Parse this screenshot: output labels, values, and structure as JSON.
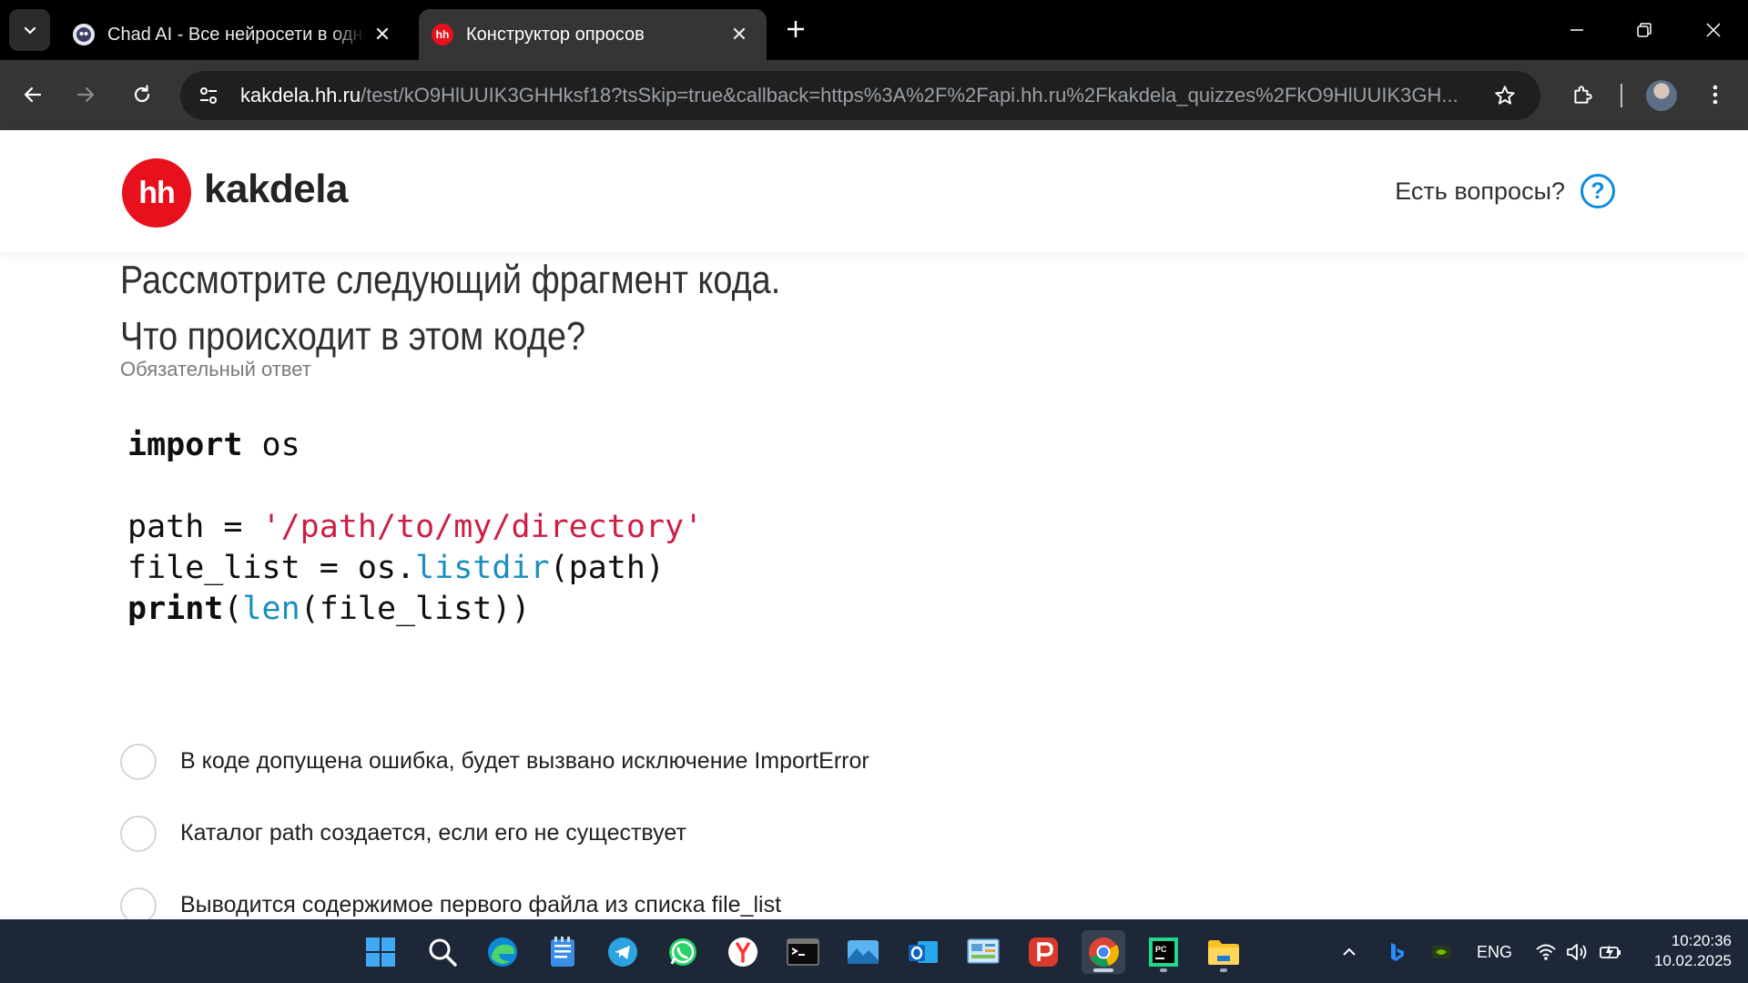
{
  "browser": {
    "tabs": [
      {
        "title": "Chad AI - Все нейросети в одном",
        "active": false
      },
      {
        "title": "Конструктор опросов",
        "active": true
      }
    ],
    "favicon_hh": "hh",
    "url_host": "kakdela.hh.ru",
    "url_rest": "/test/kO9HlUUIK3GHHksf18?tsSkip=true&callback=https%3A%2F%2Fapi.hh.ru%2Fkakdela_quizzes%2FkO9HlUUIK3GH..."
  },
  "header": {
    "logo_mark": "hh",
    "logo_text": "kakdela",
    "help_text": "Есть вопросы?",
    "help_icon_glyph": "?"
  },
  "question": {
    "line1": "Рассмотрите следующий фрагмент кода.",
    "line2": "Что происходит в этом коде?",
    "required": "Обязательный ответ"
  },
  "code": {
    "l1_kw": "import",
    "l1_rest": " os",
    "l3_a": "path = ",
    "l3_str": "'/path/to/my/directory'",
    "l4_a": "file_list = os.",
    "l4_fn": "listdir",
    "l4_b": "(path)",
    "l5_kw": "print",
    "l5_a": "(",
    "l5_fn": "len",
    "l5_b": "(file_list))"
  },
  "options": [
    {
      "label": "В коде допущена ошибка, будет вызвано исключение ImportError"
    },
    {
      "label": "Каталог path создается, если его не существует"
    },
    {
      "label": "Выводится содержимое первого файла из списка file_list"
    }
  ],
  "taskbar": {
    "apps": [
      "windows-start-icon",
      "search-icon",
      "edge-icon",
      "notepad-icon",
      "telegram-icon",
      "whatsapp-icon",
      "yandex-browser-icon",
      "terminal-icon",
      "photos-icon",
      "outlook-icon",
      "control-panel-icon",
      "psiphon-icon",
      "chrome-icon",
      "pycharm-icon",
      "file-explorer-icon"
    ],
    "lang": "ENG",
    "time": "10:20:36",
    "date": "10.02.2025"
  },
  "colors": {
    "brand_red": "#e8101d",
    "help_blue": "#0d8ce0",
    "code_string": "#cc1f44",
    "code_function": "#1a8fbf"
  }
}
